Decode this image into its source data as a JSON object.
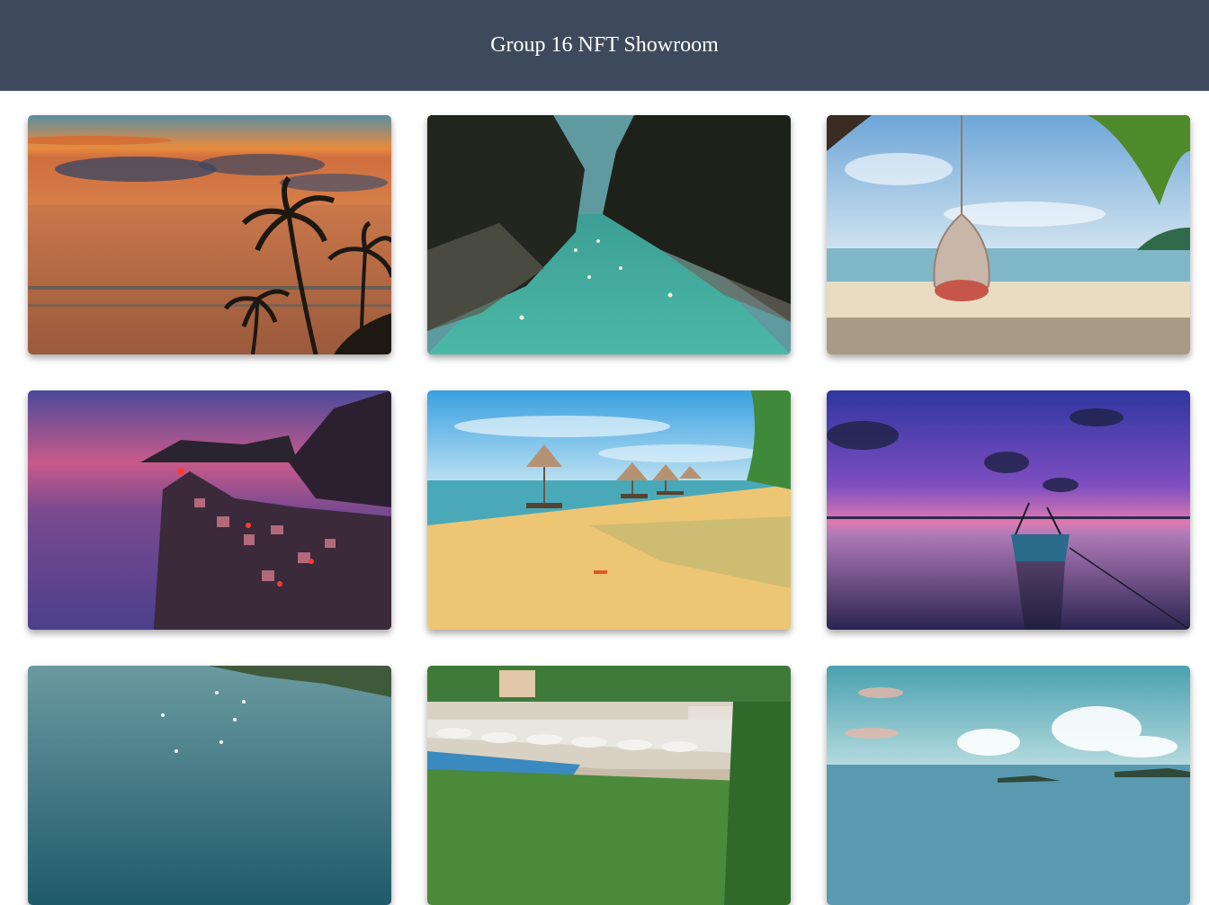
{
  "header": {
    "title": "Group 16 NFT Showroom"
  },
  "gallery": {
    "items": [
      {
        "name": "sunset-palms"
      },
      {
        "name": "river-canyon"
      },
      {
        "name": "beach-hanging-chair"
      },
      {
        "name": "coastal-village-dusk"
      },
      {
        "name": "beach-umbrellas"
      },
      {
        "name": "boat-purple-sunset"
      },
      {
        "name": "bay-with-boats"
      },
      {
        "name": "resort-beach"
      },
      {
        "name": "tropical-island-sea"
      }
    ]
  }
}
